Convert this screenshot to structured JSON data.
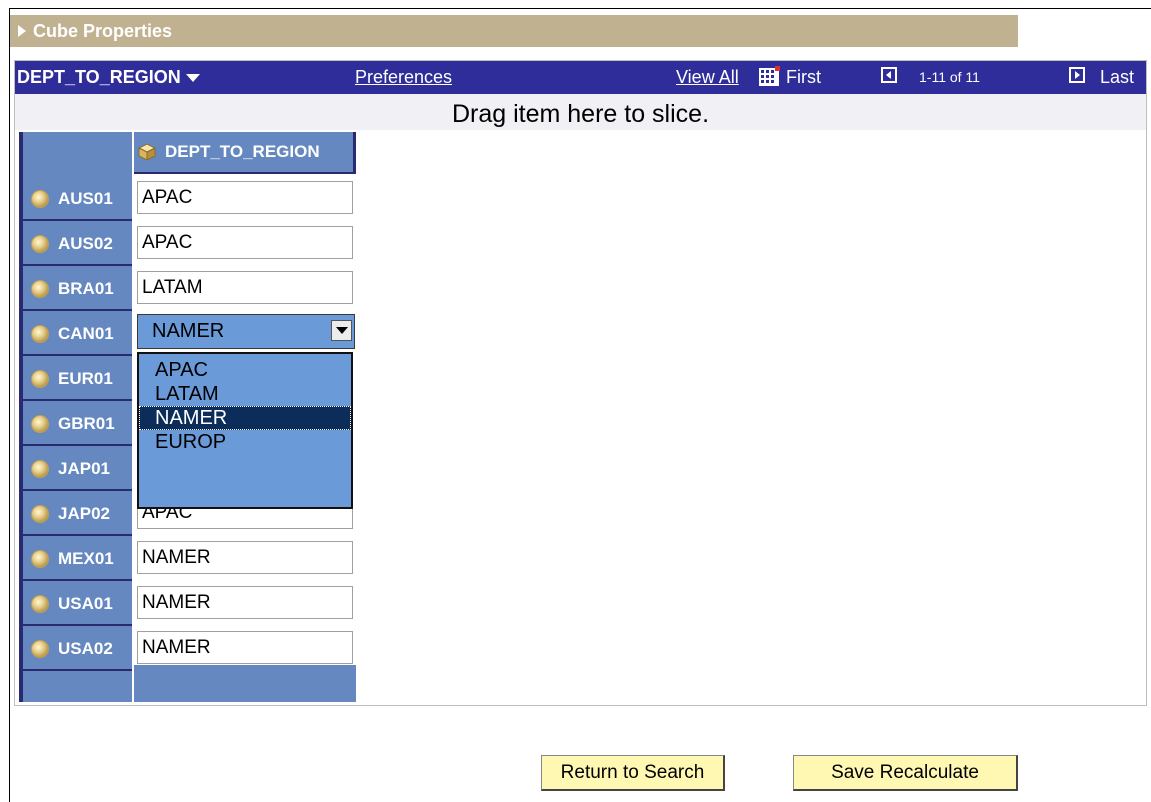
{
  "cube_properties": {
    "label": "Cube Properties"
  },
  "nav": {
    "dimension": "DEPT_TO_REGION",
    "preferences": "Preferences",
    "view_all": "View All",
    "first": "First",
    "count": "1-11 of 11",
    "last": "Last"
  },
  "slice_hint": "Drag item here to slice.",
  "column_header": "DEPT_TO_REGION",
  "rows": [
    {
      "dept": "AUS01",
      "value": "APAC"
    },
    {
      "dept": "AUS02",
      "value": "APAC"
    },
    {
      "dept": "BRA01",
      "value": "LATAM"
    },
    {
      "dept": "CAN01",
      "value": "NAMER"
    },
    {
      "dept": "EUR01",
      "value": ""
    },
    {
      "dept": "GBR01",
      "value": ""
    },
    {
      "dept": "JAP01",
      "value": ""
    },
    {
      "dept": "JAP02",
      "value": "APAC"
    },
    {
      "dept": "MEX01",
      "value": "NAMER"
    },
    {
      "dept": "USA01",
      "value": "NAMER"
    },
    {
      "dept": "USA02",
      "value": "NAMER"
    }
  ],
  "dropdown": {
    "selected": "NAMER",
    "options": [
      "APAC",
      "LATAM",
      "NAMER",
      "EUROP"
    ]
  },
  "buttons": {
    "return_to_search": "Return to Search",
    "save_recalculate": "Save Recalculate"
  },
  "colors": {
    "header_bar": "#c0b291",
    "nav_bar": "#2e2d99",
    "dimension_column": "#6688c0",
    "button_fill": "#fff8b3",
    "dropdown_fill": "#6a9ad8",
    "selected_option": "#0c2d5a"
  }
}
